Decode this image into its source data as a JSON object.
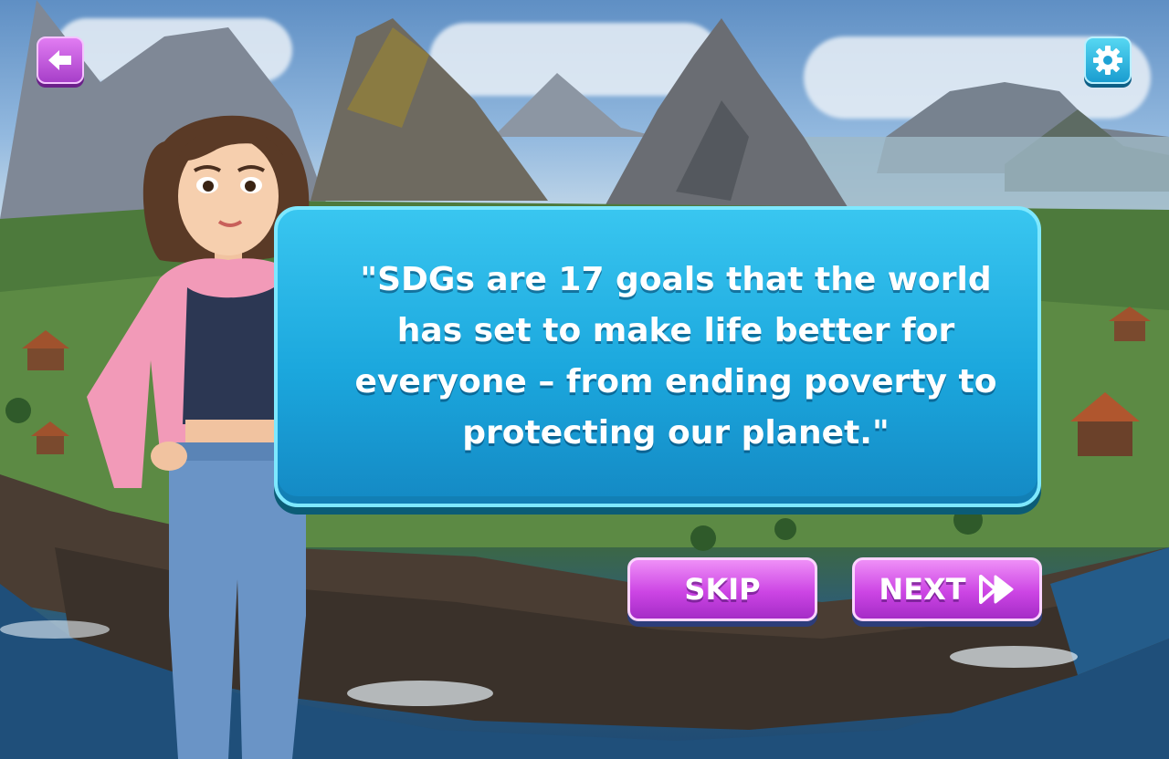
{
  "dialogue": {
    "text": "\"SDGs are 17 goals that the world has set to make life better for everyone – from ending poverty to protecting our planet.\""
  },
  "buttons": {
    "skip_label": "SKIP",
    "next_label": "NEXT"
  },
  "icons": {
    "back": "arrow-left-icon",
    "settings": "gear-icon",
    "next": "fast-forward-icon"
  },
  "colors": {
    "dialog_bg": "#1ba7dd",
    "dialog_border": "#7ee8ff",
    "purple_button": "#cc45e4",
    "cyan_button": "#1a9dd0"
  }
}
